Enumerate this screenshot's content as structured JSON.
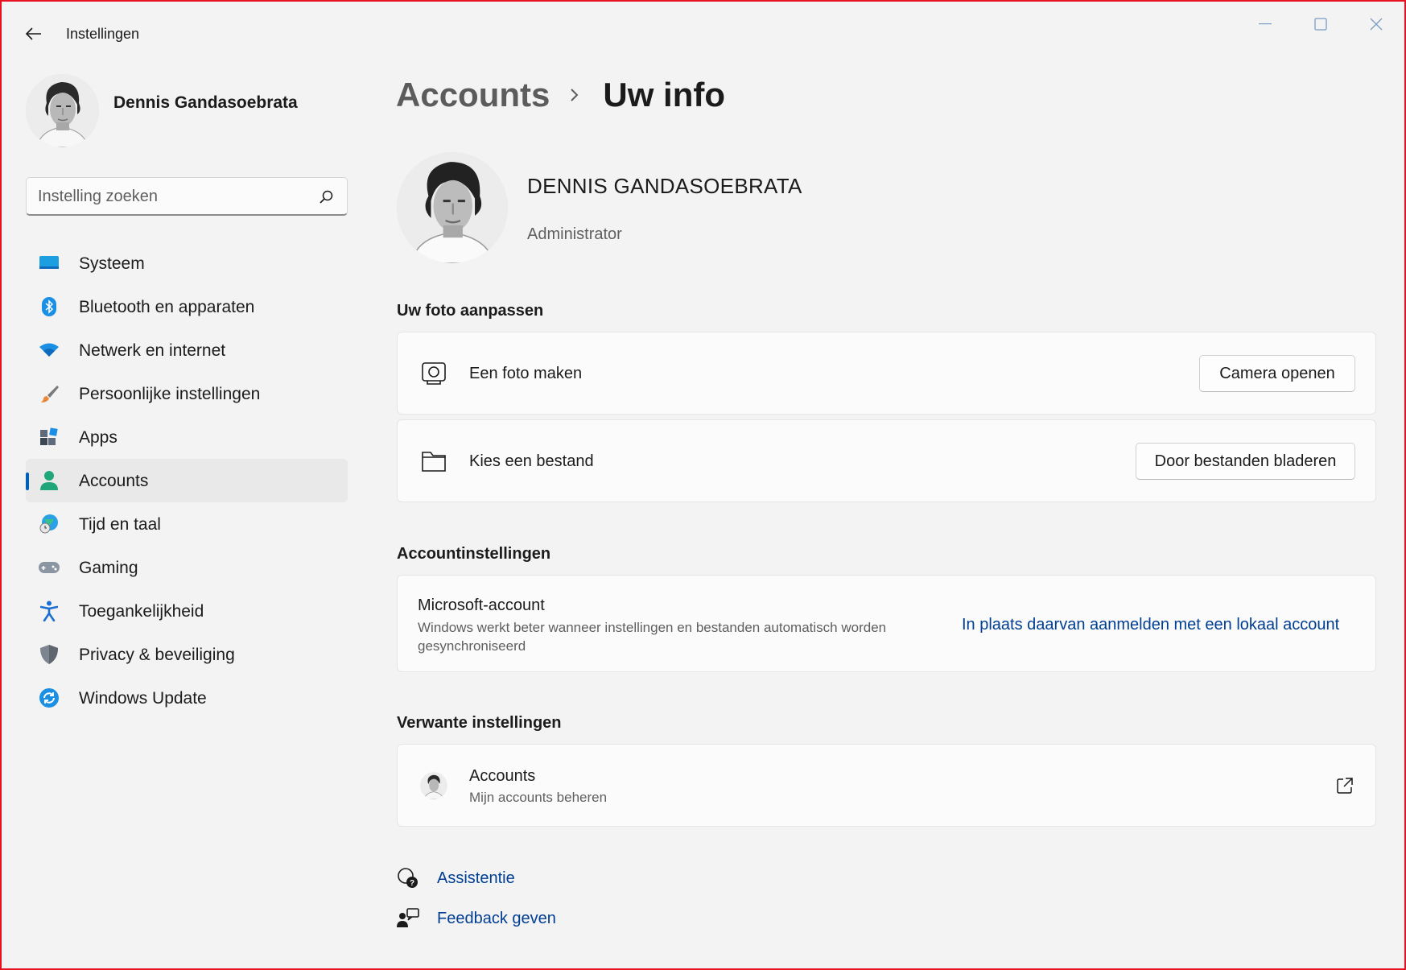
{
  "window": {
    "title": "Instellingen",
    "controls": [
      "minimize-icon",
      "maximize-icon",
      "close-icon"
    ]
  },
  "sidebar": {
    "user_name": "Dennis Gandasoebrata",
    "search_placeholder": "Instelling zoeken",
    "items": [
      {
        "label": "Systeem",
        "icon": "monitor-icon"
      },
      {
        "label": "Bluetooth en apparaten",
        "icon": "bluetooth-icon"
      },
      {
        "label": "Netwerk en internet",
        "icon": "wifi-icon"
      },
      {
        "label": "Persoonlijke instellingen",
        "icon": "paintbrush-icon"
      },
      {
        "label": "Apps",
        "icon": "apps-icon"
      },
      {
        "label": "Accounts",
        "icon": "person-icon",
        "active": true
      },
      {
        "label": "Tijd en taal",
        "icon": "globe-clock-icon"
      },
      {
        "label": "Gaming",
        "icon": "gamepad-icon"
      },
      {
        "label": "Toegankelijkheid",
        "icon": "accessibility-icon"
      },
      {
        "label": "Privacy & beveiliging",
        "icon": "shield-icon"
      },
      {
        "label": "Windows Update",
        "icon": "sync-icon"
      }
    ]
  },
  "main": {
    "breadcrumb": {
      "parent": "Accounts",
      "current": "Uw info"
    },
    "user": {
      "name": "DENNIS GANDASOEBRATA",
      "role": "Administrator"
    },
    "photo_section": {
      "title": "Uw foto aanpassen",
      "take_photo": {
        "label": "Een foto maken",
        "button": "Camera openen"
      },
      "choose_file": {
        "label": "Kies een bestand",
        "button": "Door bestanden bladeren"
      }
    },
    "account_section": {
      "title": "Accountinstellingen",
      "label": "Microsoft-account",
      "description_line1": "Windows werkt beter wanneer instellingen en bestanden automatisch worden",
      "description_line2": "gesynchroniseerd",
      "link": "In plaats daarvan aanmelden met een lokaal account"
    },
    "related_section": {
      "title": "Verwante instellingen",
      "label": "Accounts",
      "subtitle": "Mijn accounts beheren"
    },
    "help_links": {
      "assist": "Assistentie",
      "feedback": "Feedback geven"
    }
  },
  "colors": {
    "accent": "#005fb8",
    "link": "#003e92",
    "window_border": "#e81123",
    "background": "#f3f3f3"
  }
}
